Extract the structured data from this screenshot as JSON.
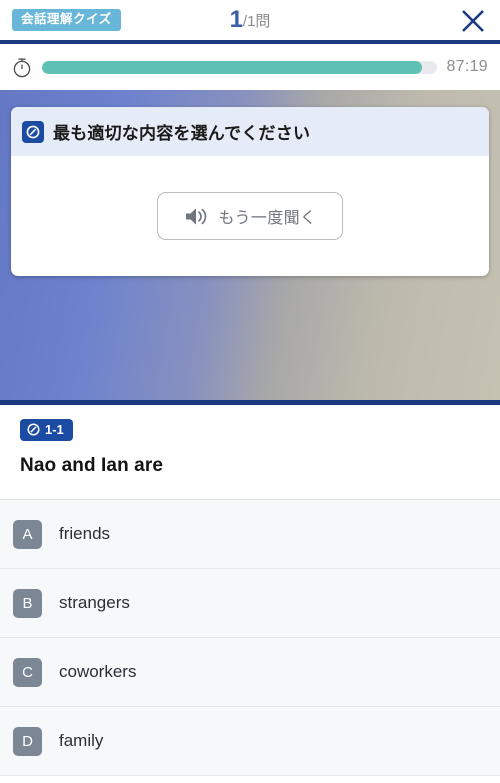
{
  "header": {
    "quiz_badge": "会話理解クイズ",
    "current_question": "1",
    "total_questions": "/1問",
    "close_icon": "close-icon",
    "accent_navy": "#1b3a80",
    "badge_color": "#68b6d8"
  },
  "timer": {
    "icon": "stopwatch-icon",
    "time_remaining": "87:19",
    "progress_percent": 96,
    "fill_color": "#5fc0b4",
    "track_color": "#e8eaed"
  },
  "media_card": {
    "instruction": "最も適切な内容を選んでください",
    "instruction_icon": "question-circle-slash-icon",
    "listen_button_label": "もう一度聞く",
    "listen_button_icon": "speaker-icon",
    "header_bg": "#e6ecf7"
  },
  "question": {
    "number_badge": "1-1",
    "number_badge_icon": "question-circle-slash-icon",
    "prompt": "Nao and Ian are",
    "badge_color": "#1b4ba3"
  },
  "options": [
    {
      "letter": "A",
      "text": "friends"
    },
    {
      "letter": "B",
      "text": "strangers"
    },
    {
      "letter": "C",
      "text": "coworkers"
    },
    {
      "letter": "D",
      "text": "family"
    }
  ]
}
